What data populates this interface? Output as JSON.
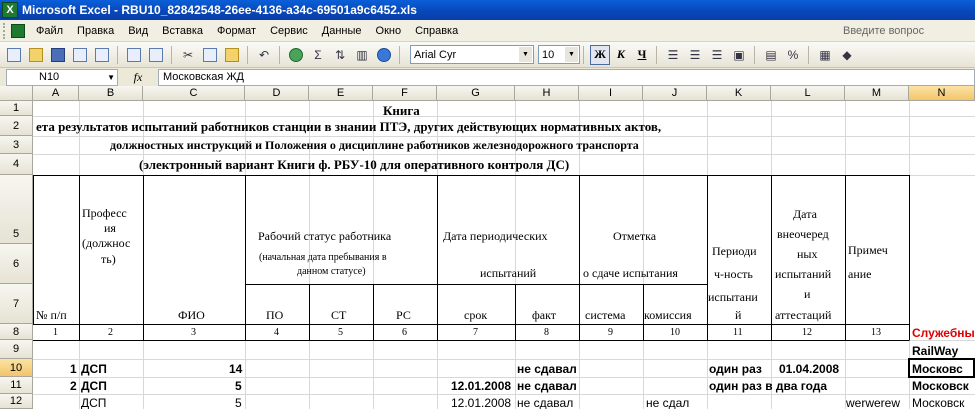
{
  "window": {
    "title": "Microsoft Excel - RBU10_82842548-26ee-4136-a34c-69501a9c6452.xls",
    "icon": "excel-icon"
  },
  "menu": {
    "items": [
      "Файл",
      "Правка",
      "Вид",
      "Вставка",
      "Формат",
      "Сервис",
      "Данные",
      "Окно",
      "Справка"
    ],
    "help_placeholder": "Введите вопрос"
  },
  "toolbar": {
    "font_name": "Arial Cyr",
    "font_size": "10",
    "bold_label": "Ж",
    "italic_label": "К",
    "underline_label": "Ч",
    "percent_label": "%"
  },
  "formula_bar": {
    "name_box": "N10",
    "fx_label": "fx",
    "value": "Московская ЖД"
  },
  "columns": [
    "A",
    "B",
    "C",
    "D",
    "E",
    "F",
    "G",
    "H",
    "I",
    "J",
    "K",
    "L",
    "M",
    "N"
  ],
  "rows": [
    "1",
    "2",
    "3",
    "4",
    "5",
    "6",
    "7",
    "8",
    "9",
    "10",
    "11",
    "12"
  ],
  "sheet": {
    "title": "Книга",
    "line2": "ета результатов испытаний работников станции в знании ПТЭ, других действующих нормативных актов,",
    "line3": "должностных инструкций и Положения о дисциплине работников железнодорожного транспорта",
    "line4": "(электронный вариант Книги ф. РБУ-10 для оперативного контроля ДС)",
    "hdr": {
      "num": "№ п/п",
      "prof": [
        "Професс",
        "ия",
        "(должнос",
        "ть)"
      ],
      "fio": "ФИО",
      "status": "Рабочий статус работника",
      "status_sub": [
        "(начальная дата пребывания в",
        "данном статусе)"
      ],
      "po": "ПО",
      "st": "СТ",
      "rs": "РС",
      "periodic": "Дата периодических",
      "periodic2": "испытаний",
      "srok": "срок",
      "fakt": "факт",
      "mark": "Отметка",
      "mark2": "о сдаче испытания",
      "sistema": "система",
      "komissiya": "комиссия",
      "period": [
        "Периоди",
        "ч-ность",
        "испытани",
        "й"
      ],
      "vneoch": [
        "Дата",
        "внеочеред",
        "ных",
        "испытаний",
        "и",
        "аттестаций"
      ],
      "prim": [
        "Примеч",
        "ание"
      ]
    },
    "col_numbers": [
      "1",
      "2",
      "3",
      "4",
      "5",
      "6",
      "7",
      "8",
      "9",
      "10",
      "11",
      "12",
      "13"
    ],
    "n8": "Служебны",
    "n9": "RailWay",
    "r10": {
      "a": "1",
      "b": "ДСП",
      "c": "14",
      "h": "не сдавал",
      "k": "один раз",
      "l": "01.04.2008",
      "n": "Московс"
    },
    "r11": {
      "a": "2",
      "b": "ДСП",
      "c": "5",
      "g": "12.01.2008",
      "h": "не сдавал",
      "k": "один раз в два года",
      "n": "Московск"
    },
    "r12": {
      "b": "ДСП",
      "c": "5",
      "g": "12.01.2008",
      "h": "не сдавал",
      "j": "не сдал",
      "m": "werwerew",
      "n": "Московск"
    }
  }
}
